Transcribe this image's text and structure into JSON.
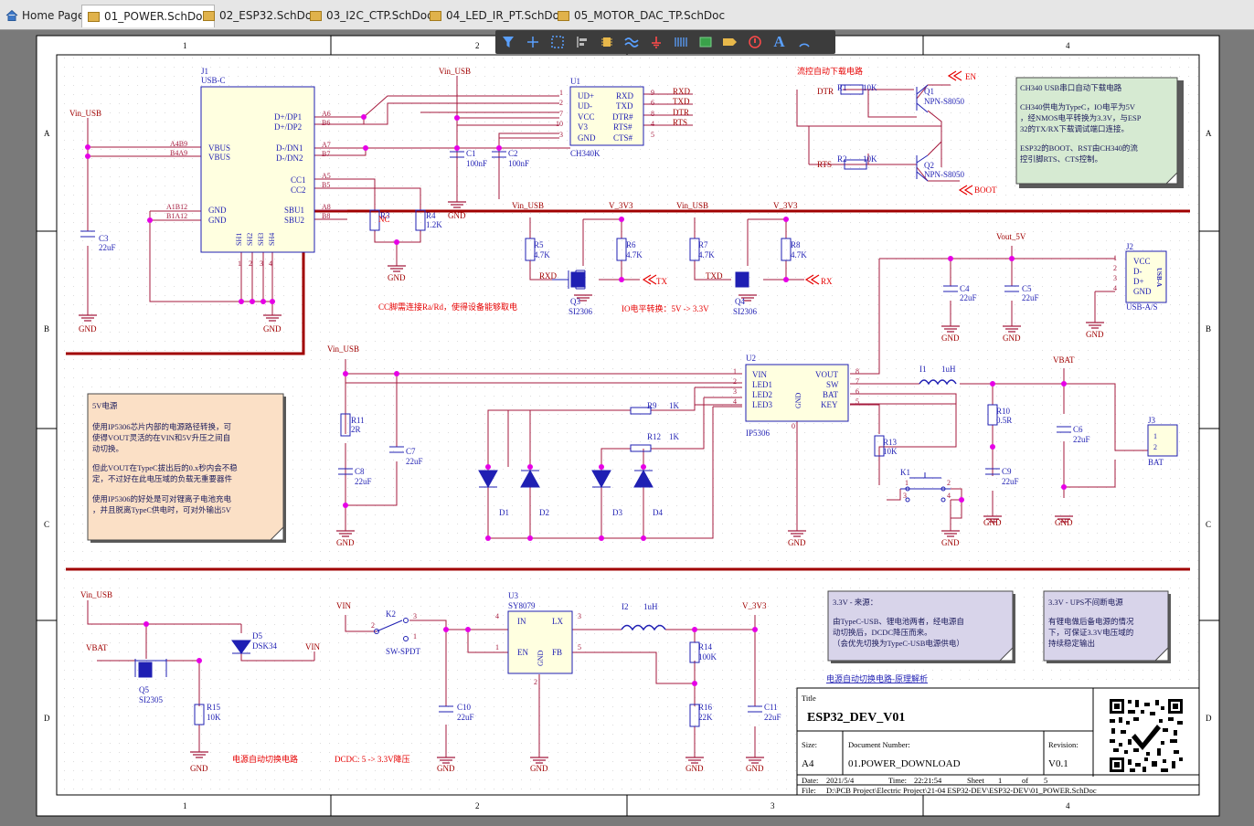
{
  "tabs": [
    {
      "label": "Home Page",
      "icon": "home-icon",
      "active": false
    },
    {
      "label": "01_POWER.SchDoc",
      "icon": "schdoc-icon",
      "active": true
    },
    {
      "label": "02_ESP32.SchDoc",
      "icon": "schdoc-icon",
      "active": false
    },
    {
      "label": "03_I2C_CTP.SchDoc",
      "icon": "schdoc-icon",
      "active": false
    },
    {
      "label": "04_LED_IR_PT.SchDoc",
      "icon": "schdoc-icon",
      "active": false
    },
    {
      "label": "05_MOTOR_DAC_TP.SchDoc",
      "icon": "schdoc-icon",
      "active": false
    }
  ],
  "toolbar": [
    "filter-icon",
    "place-wire-icon",
    "select-area-icon",
    "align-icon",
    "place-part-icon",
    "place-bus-icon",
    "place-power-icon",
    "place-harness-icon",
    "place-sheet-icon",
    "place-port-icon",
    "place-directive-icon",
    "place-text-icon",
    "place-arc-icon"
  ],
  "colors": {
    "wire": "#a51a3d",
    "part": "#1f1fb3",
    "junction": "#e600e6",
    "note_red": "#e60000",
    "sheet_bg": "#ffffff",
    "border_red": "#a00000"
  },
  "zones": {
    "cols": [
      "1",
      "2",
      "3",
      "4"
    ],
    "rows": [
      "A",
      "B",
      "C",
      "D"
    ]
  },
  "text": {
    "j1": "J1",
    "j1_type": "USB-C",
    "vin_usb": "Vin_USB",
    "gnd": "GND",
    "vbus": "VBUS",
    "a4b9": "A4B9",
    "b4a9": "B4A9",
    "a1b12": "A1B12",
    "b1a12": "B1A12",
    "dp1": "D+/DP1",
    "dp2": "D+/DP2",
    "dn1": "D-/DN1",
    "dn2": "D-/DN2",
    "cc1": "CC1",
    "cc2": "CC2",
    "sbu1": "SBU1",
    "sbu2": "SBU2",
    "a6": "A6",
    "b6": "B6",
    "a7": "A7",
    "b7": "B7",
    "a5": "A5",
    "b5": "B5",
    "a8": "A8",
    "b8": "B8",
    "sh1": "SH1",
    "sh2": "SH2",
    "sh3": "SH3",
    "sh4": "SH4",
    "n1": "1",
    "n2": "2",
    "n3": "3",
    "n4": "4",
    "c3": "C3",
    "c3v": "22uF",
    "r3": "R3",
    "r3v": "NC",
    "r4": "R4",
    "r4v": "1.2K",
    "u1": "U1",
    "u1_type": "CH340K",
    "ud_p": "UD+",
    "ud_n": "UD-",
    "vcc": "VCC",
    "v3": "V3",
    "rxd": "RXD",
    "txd": "TXD",
    "dtr_n": "DTR#",
    "rts_n": "RTS#",
    "cts_n": "CTS#",
    "p1": "1",
    "p2": "2",
    "p7": "7",
    "p10": "10",
    "p3": "3",
    "p9": "9",
    "p6": "6",
    "p8": "8",
    "p4": "4",
    "p5": "5",
    "rxd_net": "RXD",
    "txd_net": "TXD",
    "dtr_net": "DTR",
    "rts_net": "RTS",
    "c1": "C1",
    "c1v": "100nF",
    "c2": "C2",
    "c2v": "100nF",
    "cc_note": "CC脚需连接Ra/Rd，使得设备能够取电",
    "v3v3": "V_3V3",
    "r5": "R5",
    "r5v": "4.7K",
    "r6": "R6",
    "r6v": "4.7K",
    "r7": "R7",
    "r7v": "4.7K",
    "r8": "R8",
    "r8v": "4.7K",
    "q3": "Q3",
    "q3t": "SI2306",
    "q4": "Q4",
    "q4t": "SI2306",
    "tx": "TX",
    "rx": "RX",
    "io_note": "IO电平转换：5V -> 3.3V",
    "flow_title": "流控自动下载电路",
    "dtr": "DTR",
    "rts": "RTS",
    "r1": "R1",
    "r1v": "10K",
    "r2": "R2",
    "r2v": "10K",
    "q1": "Q1",
    "q1t": "NPN-S8050",
    "q2": "Q2",
    "q2t": "NPN-S8050",
    "en": "EN",
    "boot": "BOOT",
    "note1_title": "CH340 USB串口自动下载电路",
    "note1_l1": "CH340供电为TypeC，IO电平为5V",
    "note1_l2": "，经NMOS电平转换为3.3V，与ESP",
    "note1_l3": "32的TX/RX下载调试端口连接。",
    "note1_l4": "ESP32的BOOT、RST由CH340的流",
    "note1_l5": "控引脚RTS、CTS控制。",
    "vout5v": "Vout_5V",
    "c4": "C4",
    "c4v": "22uF",
    "c5": "C5",
    "c5v": "22uF",
    "j2": "J2",
    "j2_type": "USB-A/S",
    "usba": "USB-A",
    "dm": "D-",
    "dpl": "D+",
    "u2": "U2",
    "u2_type": "IP5306",
    "vin": "VIN",
    "led1": "LED1",
    "led2": "LED2",
    "led3": "LED3",
    "vout": "VOUT",
    "sw": "SW",
    "bat": "BAT",
    "key": "KEY",
    "u2gnd": "GND",
    "u2_0": "0",
    "r9": "R9",
    "r9v": "1K",
    "r12": "R12",
    "r12v": "1K",
    "d1": "D1",
    "d2": "D2",
    "d3": "D3",
    "d4": "D4",
    "r11": "R11",
    "r11v": "2R",
    "c8": "C8",
    "c8v": "22uF",
    "c7": "C7",
    "c7v": "22uF",
    "l1": "I1",
    "l1v": "1uH",
    "r10": "R10",
    "r10v": "0.5R",
    "c9": "C9",
    "c9v": "22uF",
    "vbat": "VBAT",
    "c6": "C6",
    "c6v": "22uF",
    "j3": "J3",
    "j3_type": "BAT",
    "r13": "R13",
    "r13v": "10K",
    "k1": "K1",
    "note2_title": "5V电源",
    "note2_l1": "使用IP5306芯片内部的电源路径转换，可",
    "note2_l2": "使得VOUT灵活的在VIN和5V升压之间自",
    "note2_l3": "动切换。",
    "note2_l4": "但此VOUT在TypeC拔出后的0.x秒内会不稳",
    "note2_l5": "定，不过好在此电压域的负载无重要器件",
    "note2_l6": "使用IP5306的好处是可对锂离子电池充电",
    "note2_l7": "，并且脱离TypeC供电时，可对外输出5V",
    "d5": "D5",
    "d5t": "DSK34",
    "q5": "Q5",
    "q5t": "SI2305",
    "r15": "R15",
    "r15v": "10K",
    "vin_net": "VIN",
    "auto_note": "电源自动切换电路",
    "k2": "K2",
    "k2t": "SW-SPDT",
    "u3": "U3",
    "u3_type": "SY8079",
    "in": "IN",
    "en_pin": "EN",
    "lx": "LX",
    "fb": "FB",
    "u3gnd": "GND",
    "c10": "C10",
    "c10v": "22uF",
    "l2": "I2",
    "l2v": "1uH",
    "r14": "R14",
    "r14v": "100K",
    "r16": "R16",
    "r16v": "22K",
    "c11": "C11",
    "c11v": "22uF",
    "dcdc_note": "DCDC: 5 -> 3.3V降压",
    "note3_title": "3.3V - 来源：",
    "note3_l1": "由TypeC-USB、锂电池两者，经电源自",
    "note3_l2": "动切换后，DCDC降压而来。",
    "note3_l3": "（会优先切换为TypeC-USB电源供电）",
    "note4_title": "3.3V - UPS不间断电源",
    "note4_l1": "有锂电做后备电源的情况",
    "note4_l2": "下，可保证3.3V电压域的",
    "note4_l3": "持续稳定输出",
    "link": "电源自动切换电路-原理解析",
    "tb_title_lbl": "Title",
    "tb_title": "ESP32_DEV_V01",
    "tb_size_lbl": "Size:",
    "tb_size": "A4",
    "tb_doc_lbl": "Document Number:",
    "tb_doc": "01.POWER_DOWNLOAD",
    "tb_rev_lbl": "Revision:",
    "tb_rev": "V0.1",
    "tb_date_lbl": "Date:",
    "tb_date": "2021/5/4",
    "tb_time_lbl": "Time:",
    "tb_time": "22:21:54",
    "tb_sheet_lbl": "Sheet",
    "tb_sheet": "1",
    "tb_of": "of",
    "tb_total": "5",
    "tb_file_lbl": "File:",
    "tb_file": "D:\\PCB Project\\Electric Project\\21-04 ESP32-DEV\\ESP32-DEV\\01_POWER.SchDoc"
  }
}
